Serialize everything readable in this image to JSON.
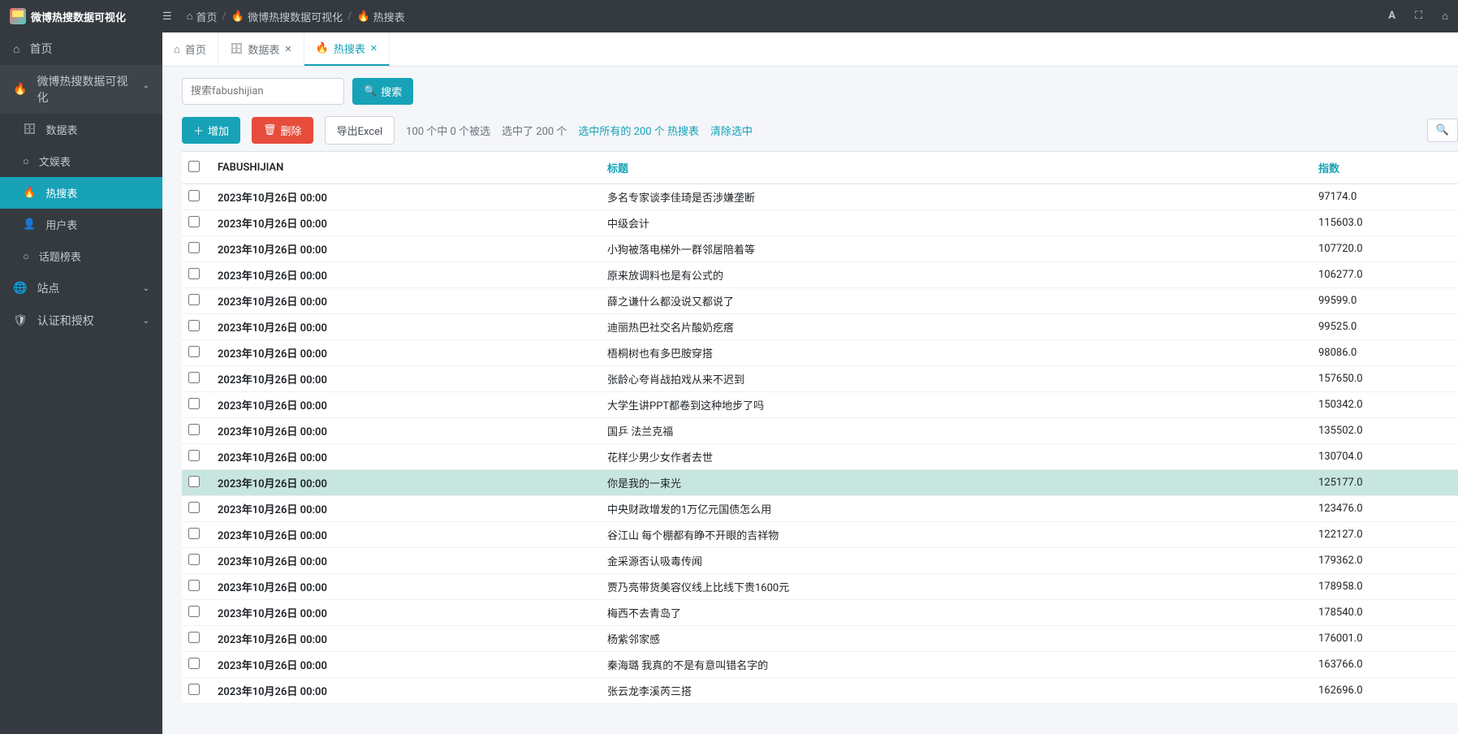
{
  "brand": "微博热搜数据可视化",
  "breadcrumbs": [
    "首页",
    "微博热搜数据可视化",
    "热搜表"
  ],
  "topbar_icons": [
    "font-icon",
    "fullscreen-icon",
    "home-icon"
  ],
  "sidebar": {
    "home": "首页",
    "group": "微博热搜数据可视化",
    "items": [
      {
        "label": "数据表",
        "icon": "database-icon"
      },
      {
        "label": "文娱表",
        "icon": "circle-icon"
      },
      {
        "label": "热搜表",
        "icon": "fire-icon",
        "active": true
      },
      {
        "label": "用户表",
        "icon": "user-icon"
      },
      {
        "label": "话题榜表",
        "icon": "circle-icon"
      }
    ],
    "site": "站点",
    "auth": "认证和授权"
  },
  "tabs": [
    {
      "label": "首页",
      "icon": "home-icon",
      "closable": false
    },
    {
      "label": "数据表",
      "icon": "database-icon",
      "closable": true
    },
    {
      "label": "热搜表",
      "icon": "fire-icon",
      "closable": true,
      "active": true
    }
  ],
  "search": {
    "placeholder": "搜索fabushijian",
    "button": "搜索"
  },
  "actions": {
    "add": "增加",
    "delete": "删除",
    "export": "导出Excel"
  },
  "summary": {
    "count": "100 个中 0 个被选",
    "selected": "选中了 200 个",
    "select_all": "选中所有的 200 个 热搜表",
    "clear": "清除选中"
  },
  "columns": {
    "fabushijian": "FABUSHIJIAN",
    "title": "标题",
    "index": "指数"
  },
  "rows": [
    {
      "d": "2023年10月26日 00:00",
      "t": "多名专家谈李佳琦是否涉嫌垄断",
      "i": "97174.0"
    },
    {
      "d": "2023年10月26日 00:00",
      "t": "中级会计",
      "i": "115603.0"
    },
    {
      "d": "2023年10月26日 00:00",
      "t": "小狗被落电梯外一群邻居陪着等",
      "i": "107720.0"
    },
    {
      "d": "2023年10月26日 00:00",
      "t": "原来放调料也是有公式的",
      "i": "106277.0"
    },
    {
      "d": "2023年10月26日 00:00",
      "t": "薛之谦什么都没说又都说了",
      "i": "99599.0"
    },
    {
      "d": "2023年10月26日 00:00",
      "t": "迪丽热巴社交名片酸奶疙瘩",
      "i": "99525.0"
    },
    {
      "d": "2023年10月26日 00:00",
      "t": "梧桐树也有多巴胺穿搭",
      "i": "98086.0"
    },
    {
      "d": "2023年10月26日 00:00",
      "t": "张龄心夸肖战拍戏从来不迟到",
      "i": "157650.0"
    },
    {
      "d": "2023年10月26日 00:00",
      "t": "大学生讲PPT都卷到这种地步了吗",
      "i": "150342.0"
    },
    {
      "d": "2023年10月26日 00:00",
      "t": "国乒 法兰克福",
      "i": "135502.0"
    },
    {
      "d": "2023年10月26日 00:00",
      "t": "花样少男少女作者去世",
      "i": "130704.0"
    },
    {
      "d": "2023年10月26日 00:00",
      "t": "你是我的一束光",
      "i": "125177.0",
      "hl": true
    },
    {
      "d": "2023年10月26日 00:00",
      "t": "中央财政增发的1万亿元国债怎么用",
      "i": "123476.0"
    },
    {
      "d": "2023年10月26日 00:00",
      "t": "谷江山 每个棚都有睁不开眼的吉祥物",
      "i": "122127.0"
    },
    {
      "d": "2023年10月26日 00:00",
      "t": "金采源否认吸毒传闻",
      "i": "179362.0"
    },
    {
      "d": "2023年10月26日 00:00",
      "t": "贾乃亮带货美容仪线上比线下贵1600元",
      "i": "178958.0"
    },
    {
      "d": "2023年10月26日 00:00",
      "t": "梅西不去青岛了",
      "i": "178540.0"
    },
    {
      "d": "2023年10月26日 00:00",
      "t": "杨紫邻家感",
      "i": "176001.0"
    },
    {
      "d": "2023年10月26日 00:00",
      "t": "秦海璐 我真的不是有意叫错名字的",
      "i": "163766.0"
    },
    {
      "d": "2023年10月26日 00:00",
      "t": "张云龙李溪芮三搭",
      "i": "162696.0"
    }
  ]
}
